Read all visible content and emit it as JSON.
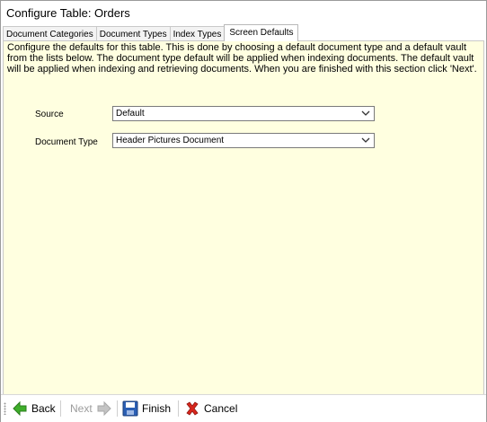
{
  "window": {
    "title": "Configure Table: Orders"
  },
  "tabs": [
    {
      "label": "Document Categories",
      "active": false
    },
    {
      "label": "Document Types",
      "active": false
    },
    {
      "label": "Index Types",
      "active": false
    },
    {
      "label": "Screen Defaults",
      "active": true
    }
  ],
  "panel": {
    "background": "#ffffe0",
    "description": "Configure the defaults for this table.  This is done by choosing a default document type and a default vault from the lists below. The document type default will be applied when indexing documents. The default vault will be applied when indexing and retrieving documents. When you are finished with this section click 'Next'.",
    "fields": {
      "source": {
        "label": "Source",
        "value": "Default"
      },
      "document_type": {
        "label": "Document Type",
        "value": "Header Pictures Document"
      }
    }
  },
  "toolbar": {
    "back": {
      "label": "Back",
      "icon": "arrow-left-icon",
      "enabled": true
    },
    "next": {
      "label": "Next",
      "icon": "arrow-right-icon",
      "enabled": false
    },
    "finish": {
      "label": "Finish",
      "icon": "floppy-disk-icon",
      "enabled": true
    },
    "cancel": {
      "label": "Cancel",
      "icon": "red-x-icon",
      "enabled": true
    }
  }
}
